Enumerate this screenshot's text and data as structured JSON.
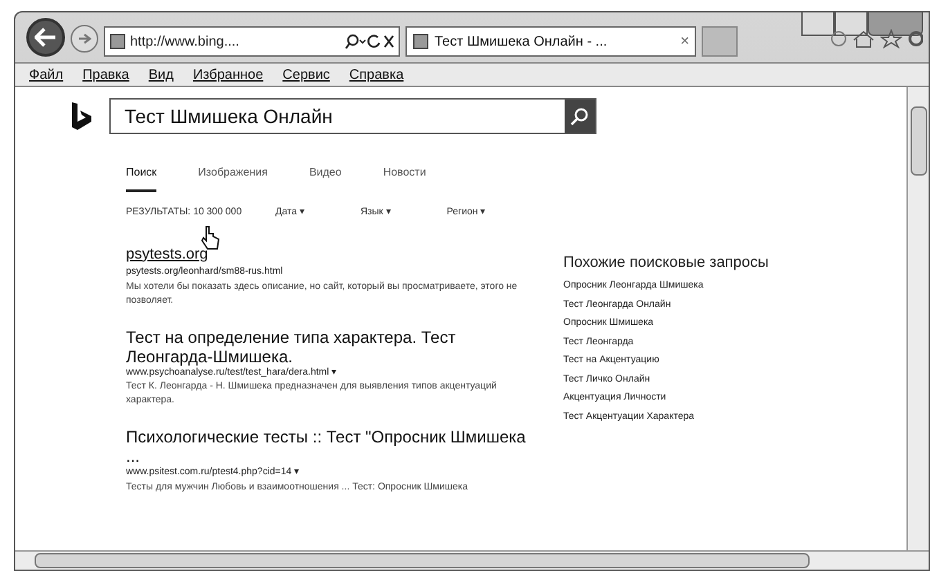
{
  "browser": {
    "address": "http://www.bing....",
    "tabs": [
      {
        "label": "Тест Шмишека Онлайн - ...",
        "selected": true,
        "close": "×"
      }
    ],
    "menu": [
      "Файл",
      "Правка",
      "Вид",
      "Избранное",
      "Сервис",
      "Справка"
    ]
  },
  "search": {
    "value": "Тест Шмишека Онлайн"
  },
  "verticals": [
    {
      "label": "Поиск",
      "selected": true
    },
    {
      "label": "Изображения",
      "selected": false
    },
    {
      "label": "Видео",
      "selected": false
    },
    {
      "label": "Новости",
      "selected": false
    }
  ],
  "result_count": "РЕЗУЛЬТАТЫ: 10 300 000",
  "filters": [
    "Дата ▾",
    "Язык ▾",
    "Регион ▾"
  ],
  "results": [
    {
      "title": "psytests.org",
      "url": "psytests.org/leonhard/sm88-rus.html",
      "snippet": "Мы хотели бы показать здесь описание, но сайт, который вы просматриваете, этого не позволяет."
    },
    {
      "title": "Тест на определение типа характера. Тест Леонгарда-Шмишека.",
      "url": "www.psychoanalyse.ru/test/test_hara/dera.html ▾",
      "snippet": "Тест К. Леонгарда - Н. Шмишека предназначен для выявления типов акцентуаций характера."
    },
    {
      "title": "Психологические тесты :: Тест \"Опросник Шмишека ...",
      "url": "www.psitest.com.ru/ptest4.php?cid=14 ▾",
      "snippet": "Тесты для мужчин Любовь и взаимоотношения ... Тест: Опросник Шмишека"
    }
  ],
  "related": {
    "heading": "Похожие поисковые запросы",
    "items": [
      "Опросник Леонгарда Шмишека",
      "Тест Леонгарда Онлайн",
      "Опросник Шмишека",
      "Тест Леонгарда",
      "Тест на Акцентуацию",
      "Тест Личко Онлайн",
      "Акцентуация Личности",
      "Тест Акцентуации Характера"
    ]
  }
}
